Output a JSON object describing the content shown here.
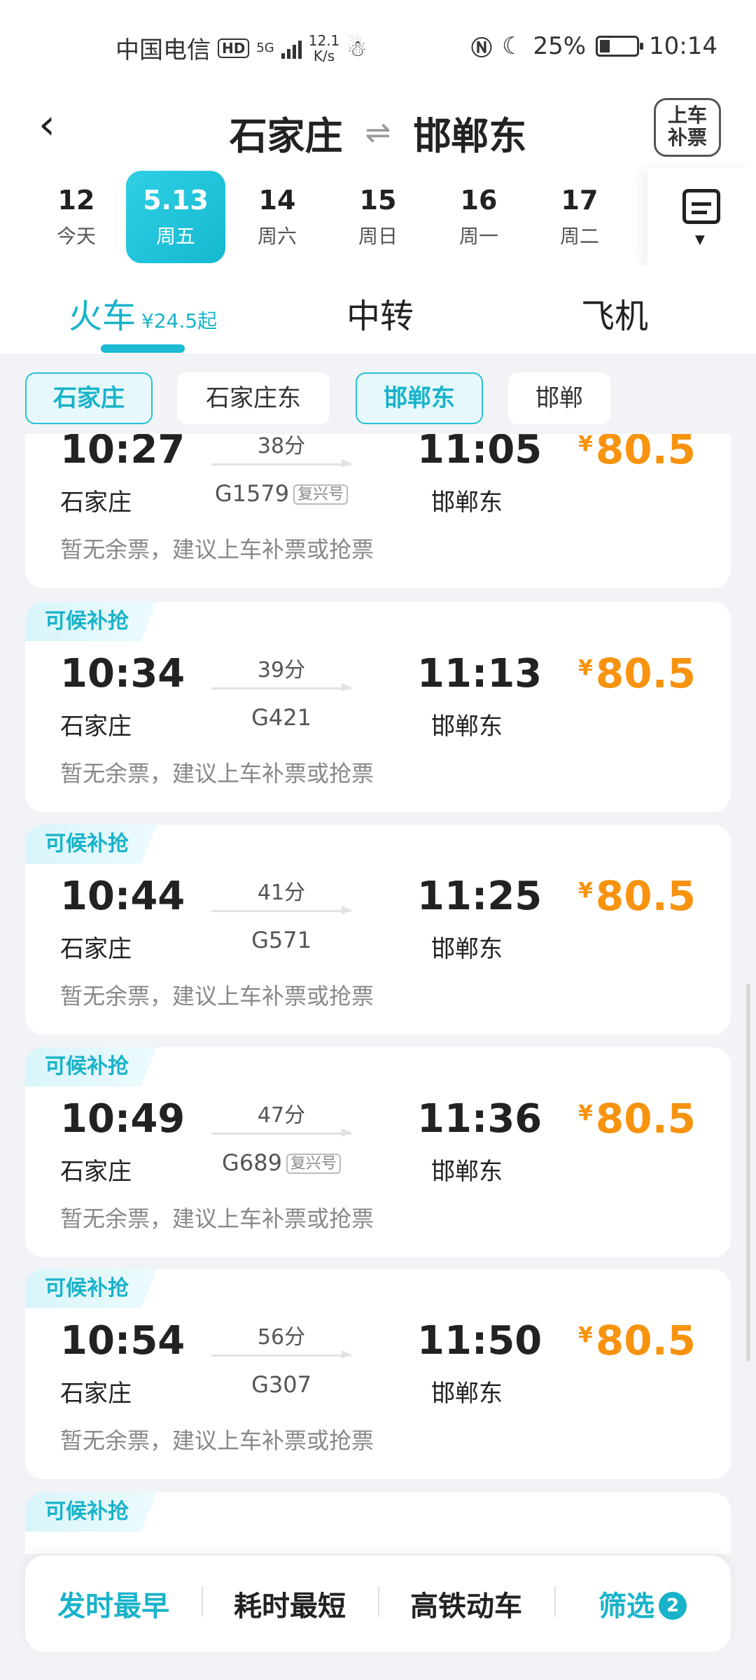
{
  "status": {
    "carrier": "中国电信",
    "hd": "HD",
    "network": "5G",
    "speed_value": "12.1",
    "speed_unit": "K/s",
    "battery": "25%",
    "time": "10:14"
  },
  "nav": {
    "from": "石家庄",
    "swap": "⇌",
    "to": "邯郸东",
    "bupiao_line1": "上车",
    "bupiao_line2": "补票"
  },
  "dates": [
    {
      "day": "12",
      "week": "今天"
    },
    {
      "day": "5.13",
      "week": "周五"
    },
    {
      "day": "14",
      "week": "周六"
    },
    {
      "day": "15",
      "week": "周日"
    },
    {
      "day": "16",
      "week": "周一"
    },
    {
      "day": "17",
      "week": "周二"
    }
  ],
  "tabs": {
    "train": "火车",
    "train_sub": "¥24.5起",
    "transfer": "中转",
    "flight": "飞机"
  },
  "station_filters": [
    "石家庄",
    "石家庄东",
    "邯郸东",
    "邯郸"
  ],
  "trains": [
    {
      "badge": "",
      "dep": "10:27",
      "dep_station": "石家庄",
      "duration": "38分",
      "no": "G1579",
      "tag": "复兴号",
      "arr": "11:05",
      "arr_station": "邯郸东",
      "currency": "¥",
      "price": "80.5",
      "hint": "暂无余票，建议上车补票或抢票"
    },
    {
      "badge": "可候补抢",
      "dep": "10:34",
      "dep_station": "石家庄",
      "duration": "39分",
      "no": "G421",
      "tag": "",
      "arr": "11:13",
      "arr_station": "邯郸东",
      "currency": "¥",
      "price": "80.5",
      "hint": "暂无余票，建议上车补票或抢票"
    },
    {
      "badge": "可候补抢",
      "dep": "10:44",
      "dep_station": "石家庄",
      "duration": "41分",
      "no": "G571",
      "tag": "",
      "arr": "11:25",
      "arr_station": "邯郸东",
      "currency": "¥",
      "price": "80.5",
      "hint": "暂无余票，建议上车补票或抢票"
    },
    {
      "badge": "可候补抢",
      "dep": "10:49",
      "dep_station": "石家庄",
      "duration": "47分",
      "no": "G689",
      "tag": "复兴号",
      "arr": "11:36",
      "arr_station": "邯郸东",
      "currency": "¥",
      "price": "80.5",
      "hint": "暂无余票，建议上车补票或抢票"
    },
    {
      "badge": "可候补抢",
      "dep": "10:54",
      "dep_station": "石家庄",
      "duration": "56分",
      "no": "G307",
      "tag": "",
      "arr": "11:50",
      "arr_station": "邯郸东",
      "currency": "¥",
      "price": "80.5",
      "hint": "暂无余票，建议上车补票或抢票"
    },
    {
      "badge": "可候补抢",
      "dep": "",
      "dep_station": "",
      "duration": "",
      "no": "",
      "tag": "",
      "arr": "",
      "arr_station": "",
      "currency": "",
      "price": "",
      "hint": ""
    }
  ],
  "bottom": {
    "earliest": "发时最早",
    "shortest": "耗时最短",
    "highspeed": "高铁动车",
    "filter": "筛选",
    "filter_count": "2"
  }
}
